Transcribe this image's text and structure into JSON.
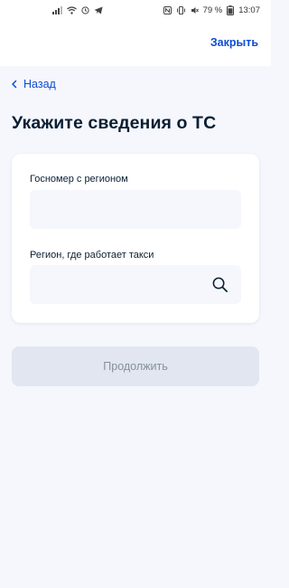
{
  "statusbar": {
    "battery_percent": "79 %",
    "time": "13:07"
  },
  "topbar": {
    "close_label": "Закрыть"
  },
  "nav": {
    "back_label": "Назад"
  },
  "page": {
    "title": "Укажите сведения о ТС"
  },
  "form": {
    "plate_label": "Госномер с регионом",
    "plate_value": "",
    "region_label": "Регион, где работает такси",
    "region_value": ""
  },
  "actions": {
    "continue_label": "Продолжить"
  },
  "colors": {
    "accent": "#0d4cd3",
    "background": "#f5f7fc",
    "disabled_button": "#e1e6f0",
    "disabled_text": "#86909c"
  }
}
